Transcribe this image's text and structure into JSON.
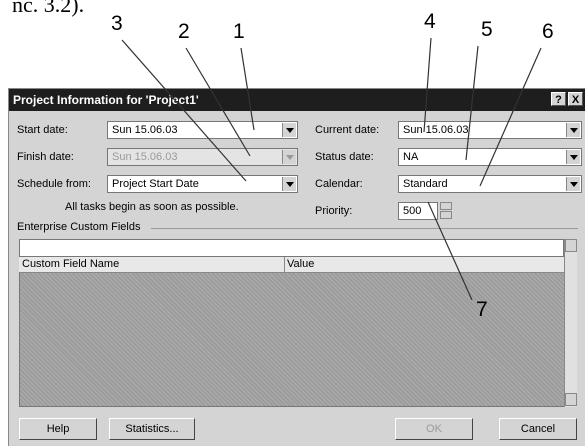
{
  "caption_fragment": "nc. 3.2).",
  "callouts": [
    "1",
    "2",
    "3",
    "4",
    "5",
    "6",
    "7"
  ],
  "dialog": {
    "title": "Project Information for 'Project1'",
    "help_glyph": "?",
    "close_glyph": "X",
    "fields": {
      "start_date": {
        "label": "Start date:",
        "value": "Sun 15.06.03"
      },
      "finish_date": {
        "label": "Finish date:",
        "value": "Sun 15.06.03"
      },
      "schedule_from": {
        "label": "Schedule from:",
        "value": "Project Start Date"
      },
      "current_date": {
        "label": "Current date:",
        "value": "Sun 15.06.03"
      },
      "status_date": {
        "label": "Status date:",
        "value": "NA"
      },
      "calendar": {
        "label": "Calendar:",
        "value": "Standard"
      },
      "priority": {
        "label": "Priority:",
        "value": "500"
      }
    },
    "note": "All tasks begin as soon as possible.",
    "enterprise_section": "Enterprise Custom Fields",
    "table": {
      "columns": [
        "Custom Field Name",
        "Value"
      ]
    },
    "buttons": {
      "help": "Help",
      "statistics": "Statistics...",
      "ok": "OK",
      "cancel": "Cancel"
    }
  }
}
